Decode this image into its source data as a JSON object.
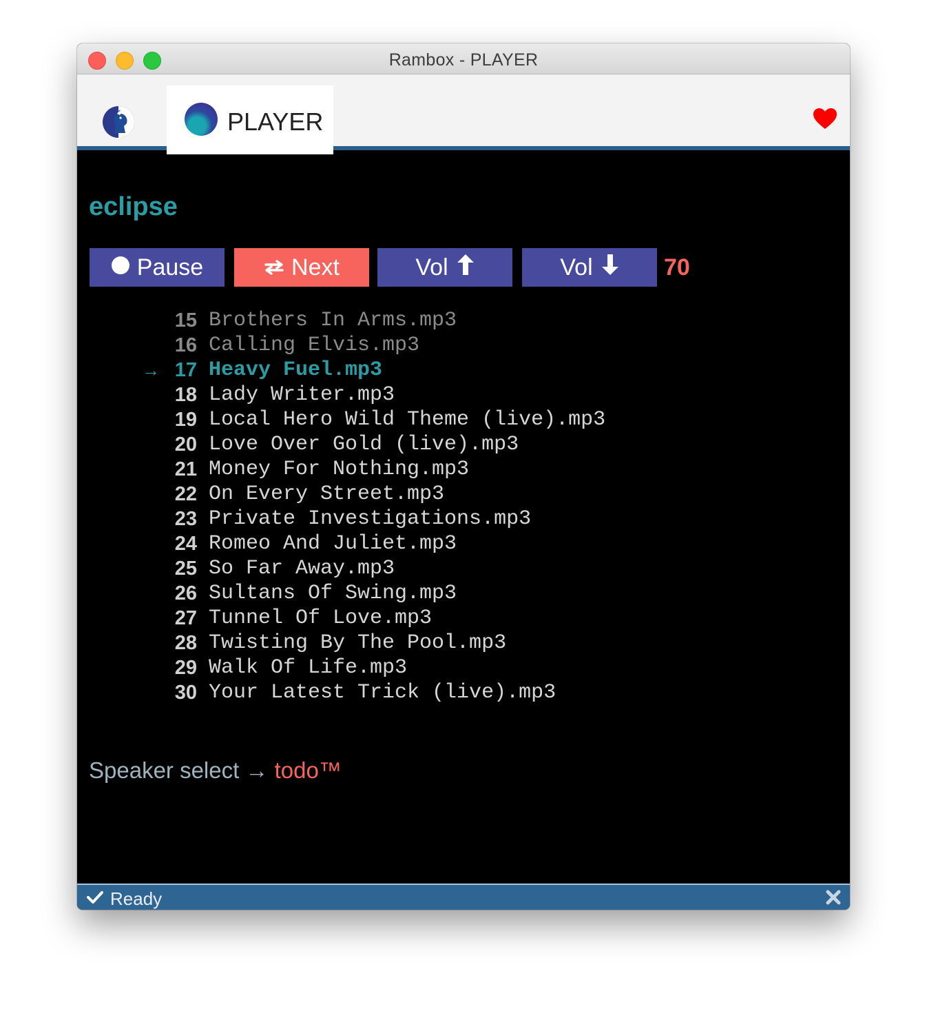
{
  "window": {
    "title": "Rambox - PLAYER"
  },
  "tabs": [
    {
      "label": "",
      "icon": "goat-icon"
    },
    {
      "label": "PLAYER",
      "icon": "player-service-icon",
      "active": true
    }
  ],
  "tabbar": {
    "favorite_icon": "heart-icon"
  },
  "player": {
    "host": "eclipse",
    "controls": {
      "pause_label": "Pause",
      "next_label": "Next",
      "vol_up_label": "Vol",
      "vol_down_label": "Vol"
    },
    "volume": "70",
    "current_marker": "→",
    "tracks": [
      {
        "num": "15",
        "name": "Brothers In Arms.mp3",
        "state": "played"
      },
      {
        "num": "16",
        "name": "Calling Elvis.mp3",
        "state": "played"
      },
      {
        "num": "17",
        "name": "Heavy Fuel.mp3",
        "state": "playing"
      },
      {
        "num": "18",
        "name": "Lady Writer.mp3",
        "state": "queued"
      },
      {
        "num": "19",
        "name": "Local Hero Wild Theme (live).mp3",
        "state": "queued"
      },
      {
        "num": "20",
        "name": "Love Over Gold (live).mp3",
        "state": "queued"
      },
      {
        "num": "21",
        "name": "Money For Nothing.mp3",
        "state": "queued"
      },
      {
        "num": "22",
        "name": "On Every Street.mp3",
        "state": "queued"
      },
      {
        "num": "23",
        "name": "Private Investigations.mp3",
        "state": "queued"
      },
      {
        "num": "24",
        "name": "Romeo And Juliet.mp3",
        "state": "queued"
      },
      {
        "num": "25",
        "name": "So Far Away.mp3",
        "state": "queued"
      },
      {
        "num": "26",
        "name": "Sultans Of Swing.mp3",
        "state": "queued"
      },
      {
        "num": "27",
        "name": "Tunnel Of Love.mp3",
        "state": "queued"
      },
      {
        "num": "28",
        "name": "Twisting By The Pool.mp3",
        "state": "queued"
      },
      {
        "num": "29",
        "name": "Walk Of Life.mp3",
        "state": "queued"
      },
      {
        "num": "30",
        "name": "Your Latest Trick (live).mp3",
        "state": "queued"
      }
    ],
    "speaker": {
      "label": "Speaker select → ",
      "value": "todo™"
    }
  },
  "statusbar": {
    "text": "Ready",
    "icon": "check-icon",
    "close_icon": "close-icon"
  },
  "colors": {
    "accent": "#2a9ca4",
    "button_primary": "#484a9d",
    "button_next": "#f7645d",
    "statusbar": "#2f6592",
    "tab_underline": "#2b5e8c",
    "heart": "#ff0000"
  }
}
